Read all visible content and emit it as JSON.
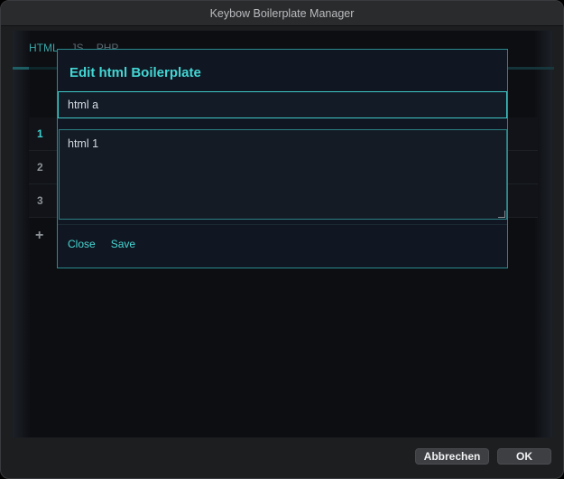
{
  "window": {
    "title": "Keybow Boilerplate Manager"
  },
  "tabs": [
    {
      "label": "HTML"
    },
    {
      "label": "JS"
    },
    {
      "label": "PHP"
    }
  ],
  "rows": [
    {
      "index": "1"
    },
    {
      "index": "2"
    },
    {
      "index": "3"
    }
  ],
  "add_button": {
    "label": "+"
  },
  "modal": {
    "title": "Edit html Boilerplate",
    "name_value": "html a",
    "content_value": "html 1",
    "close_label": "Close",
    "save_label": "Save"
  },
  "dialog_buttons": {
    "cancel_label": "Abbrechen",
    "ok_label": "OK"
  },
  "colors": {
    "accent": "#42d6d4",
    "background": "#0c0e12",
    "modal_background": "#111722"
  }
}
